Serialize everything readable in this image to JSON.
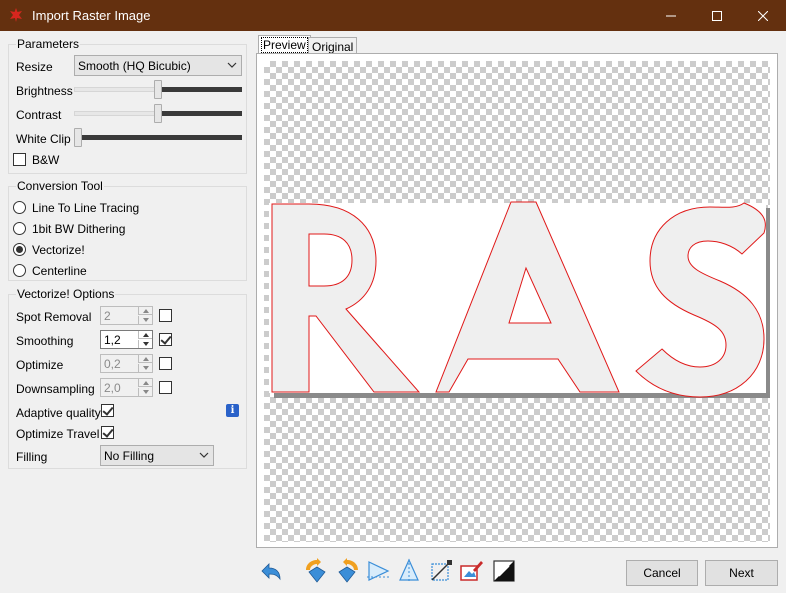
{
  "window": {
    "title": "Import Raster Image",
    "accent_color": "#64300f"
  },
  "parameters": {
    "title": "Parameters",
    "resize_label": "Resize",
    "resize_value": "Smooth (HQ Bicubic)",
    "brightness_label": "Brightness",
    "brightness_level": 0.5,
    "contrast_label": "Contrast",
    "contrast_level": 0.5,
    "whiteclip_label": "White Clip",
    "whiteclip_level": 0.0,
    "bw_label": "B&W",
    "bw_checked": false
  },
  "conversion_tool": {
    "title": "Conversion Tool",
    "options": [
      {
        "label": "Line To Line Tracing",
        "selected": false
      },
      {
        "label": "1bit BW Dithering",
        "selected": false
      },
      {
        "label": "Vectorize!",
        "selected": true
      },
      {
        "label": "Centerline",
        "selected": false
      }
    ]
  },
  "vectorize_options": {
    "title": "Vectorize! Options",
    "spot_removal": {
      "label": "Spot Removal",
      "value": "2",
      "enabled": false
    },
    "smoothing": {
      "label": "Smoothing",
      "value": "1,2",
      "enabled": true
    },
    "optimize": {
      "label": "Optimize",
      "value": "0,2",
      "enabled": false
    },
    "downsampling": {
      "label": "Downsampling",
      "value": "2,0",
      "enabled": false
    },
    "adaptive_quality": {
      "label": "Adaptive quality",
      "checked": true
    },
    "optimize_travel": {
      "label": "Optimize Travel",
      "checked": true
    },
    "filling": {
      "label": "Filling",
      "value": "No Filling"
    },
    "info_icon": "info-icon"
  },
  "tabs": [
    {
      "label": "Preview",
      "active": true
    },
    {
      "label": "Original",
      "active": false
    }
  ],
  "preview": {
    "text": "RAS",
    "outline_color": "#e01818"
  },
  "toolbar": {
    "icons": [
      "undo-icon",
      "rotate-left-icon",
      "rotate-right-icon",
      "flip-horizontal-icon",
      "flip-vertical-icon",
      "crop-icon",
      "color-picker-icon",
      "invert-icon"
    ]
  },
  "buttons": {
    "cancel": "Cancel",
    "next": "Next"
  }
}
